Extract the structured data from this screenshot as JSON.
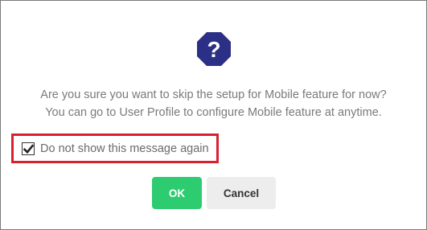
{
  "dialog": {
    "icon": "question-octagon-icon",
    "icon_color": "#2b2f86",
    "message_line1": "Are you sure you want to skip the setup for Mobile feature for now?",
    "message_line2": "You can go to User Profile to configure Mobile feature at anytime.",
    "checkbox": {
      "label": "Do not show this message again",
      "checked": true
    },
    "highlight_color": "#d9202f",
    "buttons": {
      "ok_label": "OK",
      "ok_color": "#2ecc71",
      "cancel_label": "Cancel",
      "cancel_color": "#ededed"
    }
  }
}
